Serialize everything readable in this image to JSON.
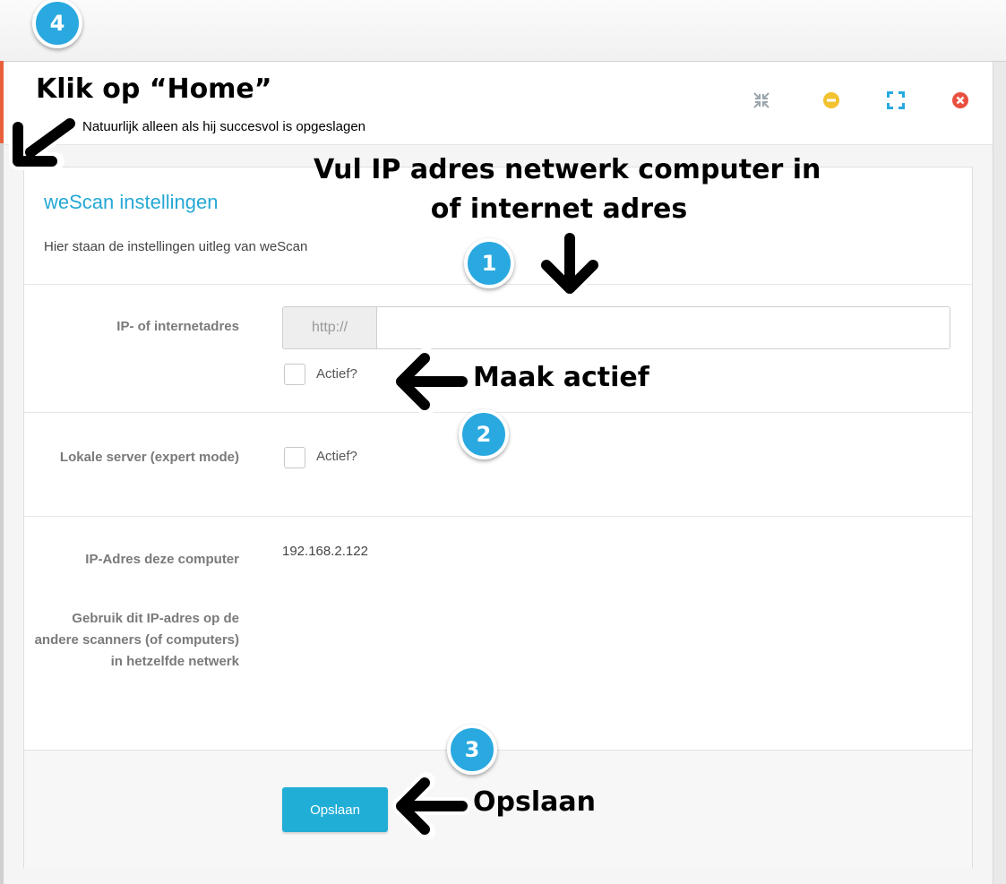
{
  "window": {
    "controls": [
      {
        "name": "shrink-icon",
        "color": "#9aa6ad"
      },
      {
        "name": "minimize-icon",
        "color": "#f2c22f"
      },
      {
        "name": "fullscreen-icon",
        "color": "#27a9e1"
      },
      {
        "name": "close-icon",
        "color": "#e9503f"
      }
    ]
  },
  "panel": {
    "title": "weScan instellingen",
    "subtitle": "Hier staan de instellingen uitleg van weScan"
  },
  "form": {
    "address_label": "IP- of internetadres",
    "address_prefix": "http://",
    "address_value": "",
    "address_active_label": "Actief?",
    "address_active_checked": false,
    "local_server_label": "Lokale server (expert mode)",
    "local_server_active_label": "Actief?",
    "local_server_active_checked": false,
    "ip_label": "IP-Adres deze computer",
    "ip_hint": "Gebruik dit IP-adres op de andere scanners (of computers) in hetzelfde netwerk",
    "ip_value": "192.168.2.122",
    "save_label": "Opslaan"
  },
  "annotations": {
    "step4_badge": "4",
    "step4_title": "Klik op “Home”",
    "step4_note": "Natuurlijk alleen als hij succesvol is opgeslagen",
    "step1_title_line1": "Vul IP adres netwerk computer in",
    "step1_title_line2": "of internet adres",
    "step1_badge": "1",
    "step2_title": "Maak actief",
    "step2_badge": "2",
    "step3_badge": "3",
    "step3_title": "Opslaan",
    "accent_color": "#2aa9e0"
  }
}
